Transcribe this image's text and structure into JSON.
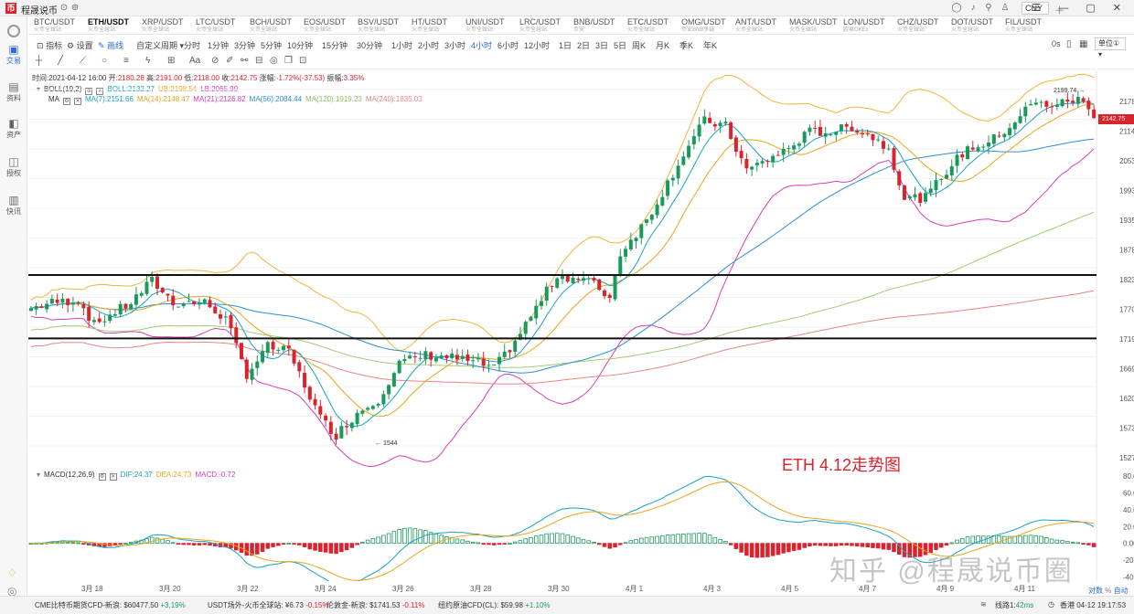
{
  "app": {
    "title": "程晟说币",
    "currency": "CNY"
  },
  "sidebar": [
    {
      "label": "交易",
      "icon": "chart-icon",
      "active": true
    },
    {
      "label": "资料",
      "icon": "document-icon"
    },
    {
      "label": "资产",
      "icon": "wallet-icon"
    },
    {
      "label": "授权",
      "icon": "key-icon"
    },
    {
      "label": "快讯",
      "icon": "news-icon"
    }
  ],
  "tabs": [
    {
      "name": "BTC/USDT",
      "sub": "火币全球站"
    },
    {
      "name": "ETH/USDT",
      "sub": "火币全球站",
      "active": true
    },
    {
      "name": "XRP/USDT",
      "sub": "火币全球站"
    },
    {
      "name": "LTC/USDT",
      "sub": "火币全球站"
    },
    {
      "name": "BCH/USDT",
      "sub": "火币全球站"
    },
    {
      "name": "EOS/USDT",
      "sub": "火币全球站"
    },
    {
      "name": "BSV/USDT",
      "sub": "火币全球站"
    },
    {
      "name": "HT/USDT",
      "sub": "火币全球站"
    },
    {
      "name": "UNI/USDT",
      "sub": "火币全球站"
    },
    {
      "name": "LRC/USDT",
      "sub": "火币全球站"
    },
    {
      "name": "BNB/USDT",
      "sub": "币安"
    },
    {
      "name": "ETC/USDT",
      "sub": "火币全球站"
    },
    {
      "name": "OMG/USDT",
      "sub": "币安BNB多链"
    },
    {
      "name": "ANT/USDT",
      "sub": "火币全球站"
    },
    {
      "name": "MASK/USDT",
      "sub": "火币全球站"
    },
    {
      "name": "LON/USDT",
      "sub": "欧易OKEx"
    },
    {
      "name": "CHZ/USDT",
      "sub": "火币全球站"
    },
    {
      "name": "DOT/USDT",
      "sub": "火币全球站"
    },
    {
      "name": "FIL/USDT",
      "sub": "火币全球站"
    }
  ],
  "toolbar": {
    "indicators": "指标",
    "settings": "设置",
    "draw": "画线",
    "custom": "自定义周期",
    "periods": [
      "分时",
      "1分钟",
      "3分钟",
      "5分钟",
      "10分钟",
      "15分钟",
      "30分钟",
      "1小时",
      "2小时",
      "3小时",
      "4小时",
      "6小时",
      "12小时",
      "1日",
      "2日",
      "3日",
      "5日",
      "周K",
      "月K",
      "季K",
      "年K"
    ],
    "active_period": "4小时",
    "right_time": "0s",
    "unit": "单位①"
  },
  "ohlc": {
    "time": "时间:2021-04-12 16:00",
    "open_l": "开:",
    "open": "2180.28",
    "high_l": "高:",
    "high": "2191.00",
    "low_l": "低:",
    "low": "2118.00",
    "close_l": "收:",
    "close": "2142.75",
    "chg_l": "涨幅:",
    "chg": "-1.72%(-37.53)",
    "amp_l": "振幅:",
    "amp": "3.35%"
  },
  "boll": {
    "name": "BOLL(19,2)",
    "boll": "BOLL:2132.27",
    "ub": "UB:2198.54",
    "lb": "LB:2065.99"
  },
  "ma": {
    "name": "MA",
    "ma7": "MA(7):2151.66",
    "ma14": "MA(14):2148.47",
    "ma21": "MA(21):2126.82",
    "ma56": "MA(56):2084.44",
    "ma120": "MA(120):1919.23",
    "ma240": "MA(240):1835.03"
  },
  "macd": {
    "name": "MACD(12,26,9)",
    "dif": "DIF:24.37",
    "dea": "DEA:24.73",
    "macd": "MACD:-0.72"
  },
  "price_axis": [
    "2178.94",
    "2114.95",
    "2053.26",
    "1993.37",
    "1935.23",
    "1878.79",
    "1823.99",
    "1770.79",
    "1719.14",
    "1669.00",
    "1620.32",
    "1573.06",
    "1527.17"
  ],
  "macd_axis": [
    "80.00",
    "60.00",
    "40.00",
    "20.00",
    "0.00",
    "-20.00",
    "-40.00"
  ],
  "date_axis": [
    "3月 18",
    "3月 20",
    "3月 22",
    "3月 24",
    "3月 26",
    "3月 28",
    "3月 30",
    "4月 1",
    "4月 3",
    "4月 5",
    "4月 7",
    "4月 9",
    "4月 11"
  ],
  "current_price": "2142.75",
  "max_label": "2199.74",
  "min_label": "1544",
  "annotation": "ETH 4.12走势图",
  "watermark": "知乎 @程晟说币圈",
  "mode": {
    "dual": "对数",
    "auto": "自动"
  },
  "status": [
    {
      "name": "CME比特币期货CFD-新浪:",
      "val": "$60477.50",
      "chg": "+3.19%",
      "up": true
    },
    {
      "name": "USDT场外-火币全球站:",
      "val": "¥6.73",
      "chg": "-0.15%",
      "up": false
    },
    {
      "name": "伦敦金-新浪:",
      "val": "$1741.53",
      "chg": "-0.11%",
      "up": false
    },
    {
      "name": "纽约原油CFD(CL):",
      "val": "$59.98",
      "chg": "+1.10%",
      "up": true
    }
  ],
  "conn": {
    "line": "线路1:",
    "ms": "42ms",
    "clock": "香港 04-12 19:17:53"
  },
  "colors": {
    "up": "#1a9a5a",
    "down": "#d9232d",
    "ma7": "#1aa0c8",
    "ma14": "#e8a51c",
    "ma21": "#d63fb8",
    "ma56": "#2b8fd8",
    "ma120": "#9fce73",
    "ma240": "#e98686",
    "boll_band": "#f0b43a",
    "dif": "#1aa0c8",
    "dea": "#e8a51c"
  },
  "chart_data": {
    "type": "candlestick",
    "symbol": "ETH/USDT",
    "period": "4小时",
    "ylim": [
      1500,
      2220
    ],
    "x_start": "2021-03-17",
    "x_end": "2021-04-12",
    "keypoints": [
      [
        0,
        1790
      ],
      [
        4,
        1800
      ],
      [
        9,
        1805
      ],
      [
        12,
        1760
      ],
      [
        19,
        1800
      ],
      [
        23,
        1840
      ],
      [
        27,
        1800
      ],
      [
        33,
        1800
      ],
      [
        37,
        1770
      ],
      [
        41,
        1670
      ],
      [
        45,
        1720
      ],
      [
        49,
        1710
      ],
      [
        55,
        1590
      ],
      [
        58,
        1560
      ],
      [
        62,
        1600
      ],
      [
        66,
        1625
      ],
      [
        70,
        1690
      ],
      [
        75,
        1705
      ],
      [
        80,
        1700
      ],
      [
        85,
        1690
      ],
      [
        88,
        1680
      ],
      [
        92,
        1730
      ],
      [
        96,
        1790
      ],
      [
        100,
        1850
      ],
      [
        106,
        1840
      ],
      [
        110,
        1810
      ],
      [
        112,
        1890
      ],
      [
        117,
        1950
      ],
      [
        120,
        2000
      ],
      [
        124,
        2070
      ],
      [
        128,
        2130
      ],
      [
        132,
        2120
      ],
      [
        136,
        2040
      ],
      [
        140,
        2060
      ],
      [
        144,
        2080
      ],
      [
        148,
        2110
      ],
      [
        152,
        2110
      ],
      [
        156,
        2120
      ],
      [
        160,
        2100
      ],
      [
        163,
        2080
      ],
      [
        166,
        1990
      ],
      [
        170,
        1990
      ],
      [
        174,
        2040
      ],
      [
        178,
        2080
      ],
      [
        182,
        2090
      ],
      [
        186,
        2120
      ],
      [
        190,
        2160
      ],
      [
        195,
        2160
      ],
      [
        199,
        2170
      ],
      [
        202,
        2143
      ]
    ],
    "horizontal_lines": [
      1850,
      1735
    ]
  }
}
